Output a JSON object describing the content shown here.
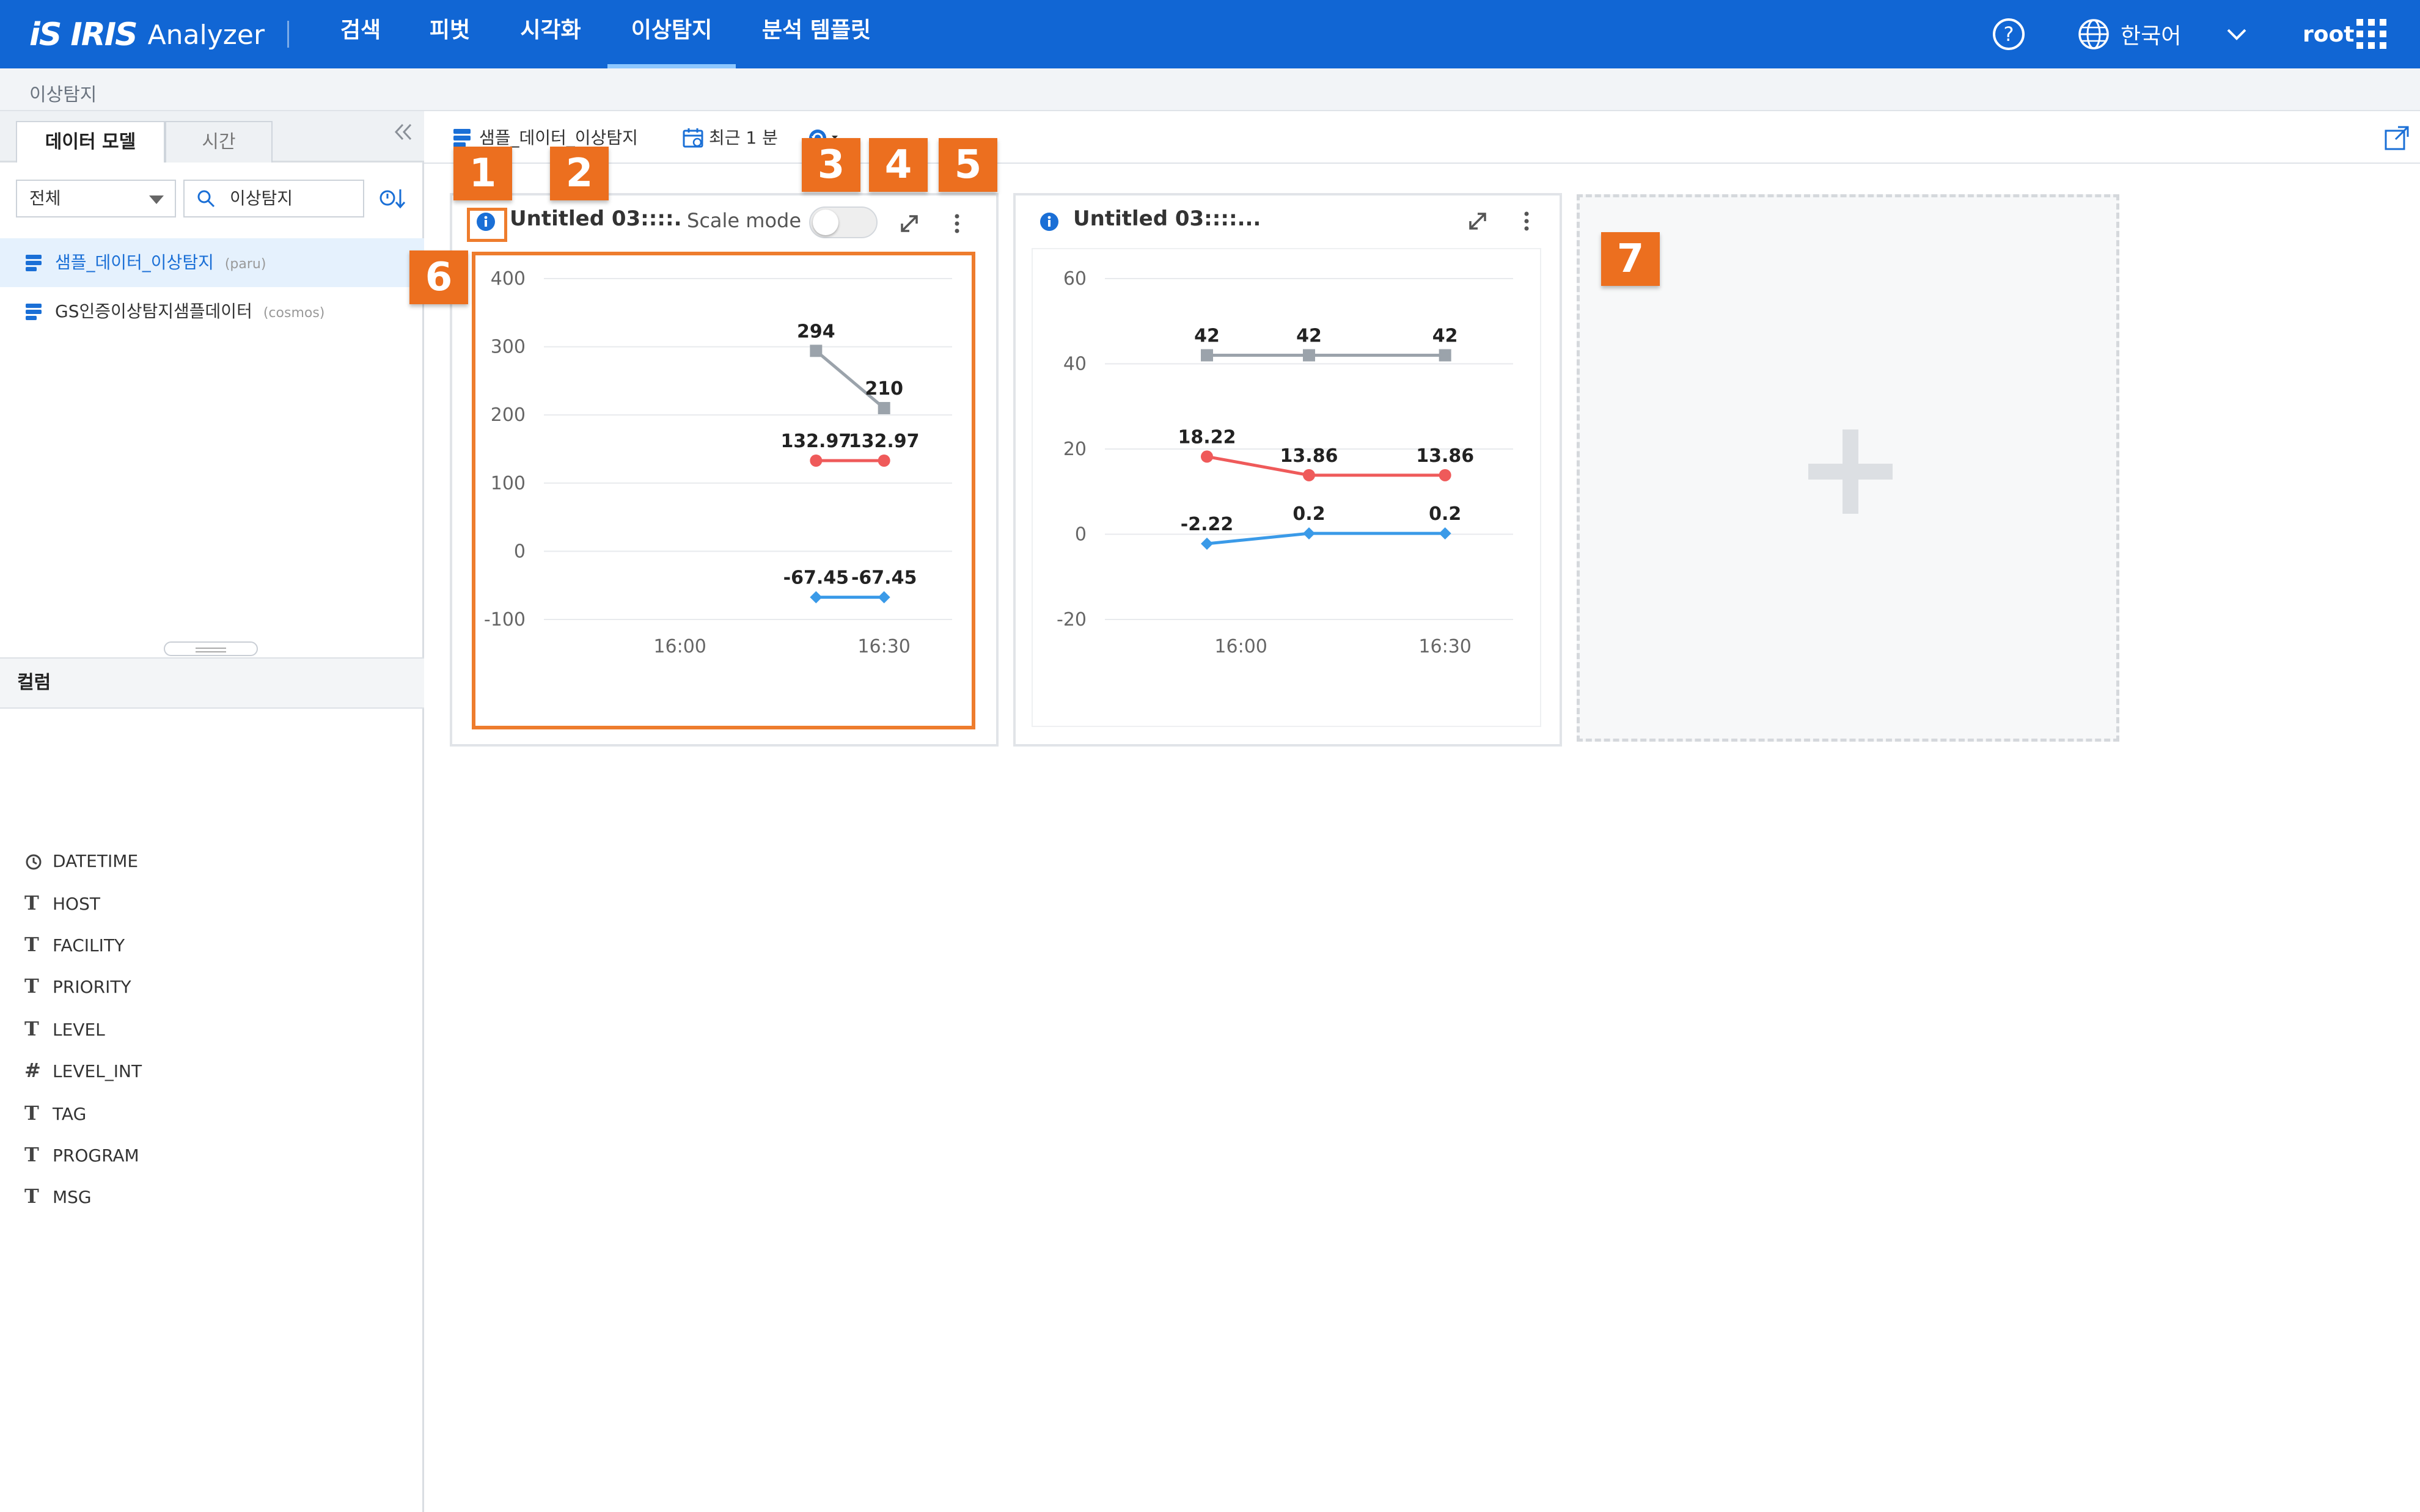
{
  "app": {
    "logo_mark": "iS IRIS",
    "logo_word": "Analyzer"
  },
  "nav": {
    "items": [
      {
        "label": "검색"
      },
      {
        "label": "피벗"
      },
      {
        "label": "시각화"
      },
      {
        "label": "이상탐지",
        "active": true
      },
      {
        "label": "분석 템플릿"
      }
    ],
    "language": "한국어",
    "user": "root"
  },
  "breadcrumb": "이상탐지",
  "left_panel": {
    "tabs": [
      {
        "label": "데이터 모델",
        "active": true
      },
      {
        "label": "시간",
        "active": false
      }
    ],
    "filter_value": "전체",
    "search_value": "이상탐지",
    "models": [
      {
        "name": "샘플_데이터_이상탐지",
        "tag": "(paru)",
        "selected": true
      },
      {
        "name": "GS인증이상탐지샘플데이터",
        "tag": "(cosmos)",
        "selected": false
      }
    ],
    "columns_header": "컬럼",
    "columns": [
      {
        "type": "clock",
        "name": "DATETIME"
      },
      {
        "type": "T",
        "name": "HOST"
      },
      {
        "type": "T",
        "name": "FACILITY"
      },
      {
        "type": "T",
        "name": "PRIORITY"
      },
      {
        "type": "T",
        "name": "LEVEL"
      },
      {
        "type": "#",
        "name": "LEVEL_INT"
      },
      {
        "type": "T",
        "name": "TAG"
      },
      {
        "type": "T",
        "name": "PROGRAM"
      },
      {
        "type": "T",
        "name": "MSG"
      }
    ]
  },
  "toolbar": {
    "model_name": "샘플_데이터_이상탐지",
    "time_range": "최근 1 분"
  },
  "panels": [
    {
      "title": "Untitled 03::::.",
      "scale_mode_label": "Scale mode"
    },
    {
      "title": "Untitled 03::::..."
    }
  ],
  "callouts": [
    "1",
    "2",
    "3",
    "4",
    "5",
    "6",
    "7"
  ],
  "colors": {
    "nav_bg": "#1166d4",
    "gray_series": "#9ba3ab",
    "red_series": "#ef5a5a",
    "blue_series": "#3a9ae8",
    "callout": "#ec6f1f"
  },
  "chart_data": [
    {
      "type": "line",
      "x_ticks": [
        "16:00",
        "16:30"
      ],
      "ylim": [
        -100,
        400
      ],
      "y_ticks": [
        400,
        300,
        200,
        100,
        0,
        -100
      ],
      "grid": true,
      "series": [
        {
          "color": "#9ba3ab",
          "marker": "square",
          "points": [
            {
              "x": "16:20",
              "y": 294,
              "label": "294"
            },
            {
              "x": "16:30",
              "y": 210,
              "label": "210"
            }
          ]
        },
        {
          "color": "#ef5a5a",
          "marker": "circle",
          "points": [
            {
              "x": "16:20",
              "y": 132.97,
              "label": "132.97"
            },
            {
              "x": "16:30",
              "y": 132.97,
              "label": "132.97"
            }
          ]
        },
        {
          "color": "#3a9ae8",
          "marker": "diamond",
          "points": [
            {
              "x": "16:20",
              "y": -67.45,
              "label": "-67.45"
            },
            {
              "x": "16:30",
              "y": -67.45,
              "label": "-67.45"
            }
          ]
        }
      ]
    },
    {
      "type": "line",
      "x_ticks": [
        "16:00",
        "16:30"
      ],
      "ylim": [
        -20,
        60
      ],
      "y_ticks": [
        60,
        40,
        20,
        0,
        -20
      ],
      "grid": true,
      "series": [
        {
          "color": "#9ba3ab",
          "marker": "square",
          "points": [
            {
              "x": "15:55",
              "y": 42,
              "label": "42"
            },
            {
              "x": "16:10",
              "y": 42,
              "label": "42"
            },
            {
              "x": "16:30",
              "y": 42,
              "label": "42"
            }
          ]
        },
        {
          "color": "#ef5a5a",
          "marker": "circle",
          "points": [
            {
              "x": "15:55",
              "y": 18.22,
              "label": "18.22"
            },
            {
              "x": "16:10",
              "y": 13.86,
              "label": "13.86"
            },
            {
              "x": "16:30",
              "y": 13.86,
              "label": "13.86"
            }
          ]
        },
        {
          "color": "#3a9ae8",
          "marker": "diamond",
          "points": [
            {
              "x": "15:55",
              "y": -2.22,
              "label": "-2.22"
            },
            {
              "x": "16:10",
              "y": 0.2,
              "label": "0.2"
            },
            {
              "x": "16:30",
              "y": 0.2,
              "label": "0.2"
            }
          ]
        }
      ]
    }
  ]
}
